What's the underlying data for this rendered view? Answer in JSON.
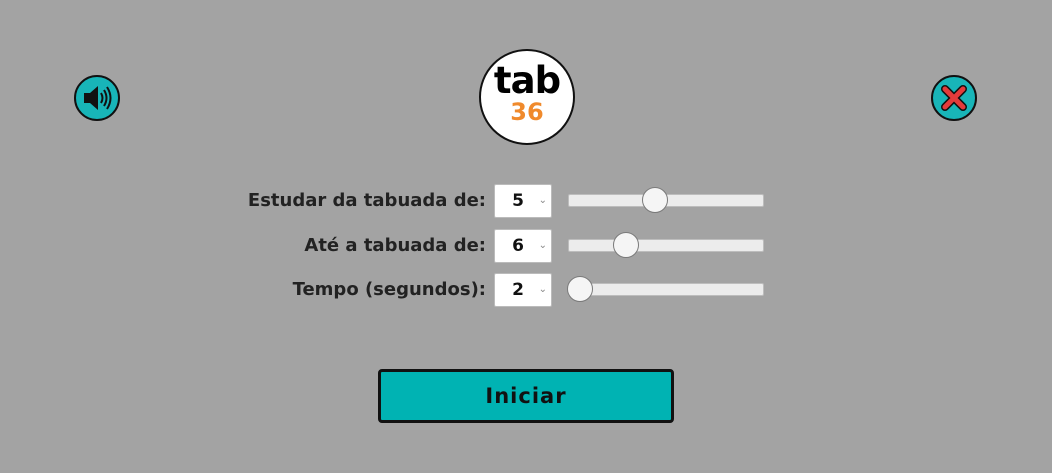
{
  "logo": {
    "line1": "tab",
    "line2": "36"
  },
  "settings": [
    {
      "label": "Estudar da tabuada de:",
      "value": "5",
      "slider_fraction": 0.44
    },
    {
      "label": "Até a tabuada de:",
      "value": "6",
      "slider_fraction": 0.27
    },
    {
      "label": "Tempo (segundos):",
      "value": "2",
      "slider_fraction": 0.0
    }
  ],
  "start_button": {
    "label": "Iniciar"
  },
  "icons": {
    "sound": "speaker-icon",
    "close": "close-x-icon"
  },
  "colors": {
    "accent": "#00b3b3",
    "logo_number": "#f08a2c",
    "close_x": "#e33b3b",
    "background": "#a3a3a3"
  }
}
